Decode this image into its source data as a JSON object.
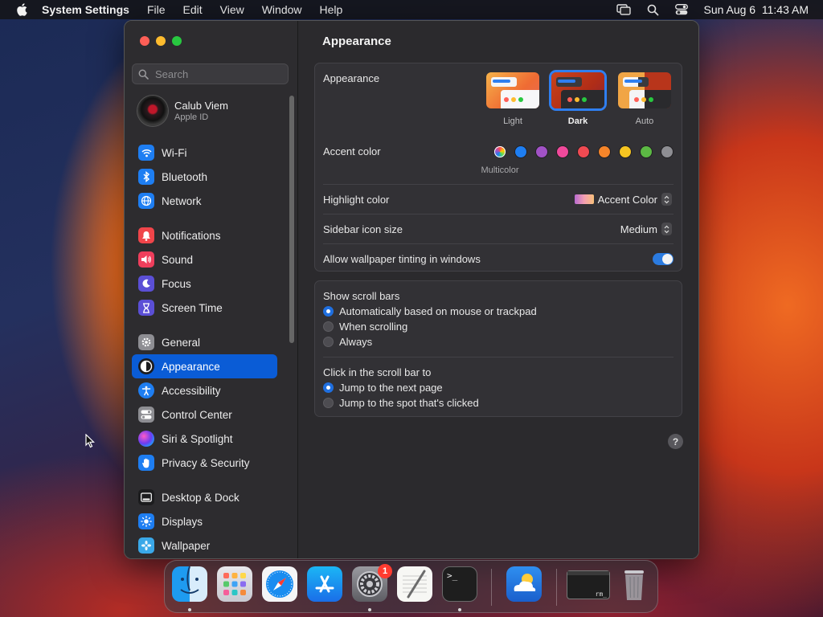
{
  "menubar": {
    "app_name": "System Settings",
    "menus": [
      "File",
      "Edit",
      "View",
      "Window",
      "Help"
    ],
    "clock": "Sun Aug 6  11:43 AM"
  },
  "sidebar": {
    "search_placeholder": "Search",
    "account": {
      "name": "Calub Viem",
      "subtitle": "Apple ID"
    },
    "sections": [
      [
        {
          "label": "Wi-Fi",
          "icon": "wifi-icon",
          "color": "#1e7ef2"
        },
        {
          "label": "Bluetooth",
          "icon": "bluetooth-icon",
          "color": "#1e7ef2"
        },
        {
          "label": "Network",
          "icon": "globe-icon",
          "color": "#1e7ef2"
        }
      ],
      [
        {
          "label": "Notifications",
          "icon": "bell-icon",
          "color": "#f0454a"
        },
        {
          "label": "Sound",
          "icon": "speaker-icon",
          "color": "#ef3e5c"
        },
        {
          "label": "Focus",
          "icon": "moon-icon",
          "color": "#5b4fd6"
        },
        {
          "label": "Screen Time",
          "icon": "hourglass-icon",
          "color": "#5b4fd6"
        }
      ],
      [
        {
          "label": "General",
          "icon": "gear-icon",
          "color": "#8e8e93"
        },
        {
          "label": "Appearance",
          "icon": "appearance-icon",
          "color": "#1c1c1e",
          "active": true
        },
        {
          "label": "Accessibility",
          "icon": "accessibility-icon",
          "color": "#1e7ef2"
        },
        {
          "label": "Control Center",
          "icon": "toggles-icon",
          "color": "#8e8e93"
        },
        {
          "label": "Siri & Spotlight",
          "icon": "siri-icon",
          "color": "#2b2b40"
        },
        {
          "label": "Privacy & Security",
          "icon": "hand-icon",
          "color": "#1e7ef2"
        }
      ],
      [
        {
          "label": "Desktop & Dock",
          "icon": "dock-icon",
          "color": "#1c1c1e"
        },
        {
          "label": "Displays",
          "icon": "sun-icon",
          "color": "#1e7ef2"
        },
        {
          "label": "Wallpaper",
          "icon": "flower-icon",
          "color": "#3aa8e8"
        }
      ]
    ]
  },
  "content": {
    "title": "Appearance",
    "appearance": {
      "label": "Appearance",
      "options": [
        {
          "label": "Light",
          "selected": false
        },
        {
          "label": "Dark",
          "selected": true
        },
        {
          "label": "Auto",
          "selected": false
        }
      ]
    },
    "accent": {
      "label": "Accent color",
      "caption": "Multicolor",
      "swatches": [
        "multicolor",
        "#1e7ef2",
        "#a152c6",
        "#f0499b",
        "#ef4a52",
        "#f5852a",
        "#f7c521",
        "#5cb944",
        "#8e8e93"
      ]
    },
    "highlight": {
      "label": "Highlight color",
      "value": "Accent Color"
    },
    "sidebar_icon_size": {
      "label": "Sidebar icon size",
      "value": "Medium"
    },
    "wallpaper_tinting": {
      "label": "Allow wallpaper tinting in windows",
      "on": true
    },
    "scroll_bars": {
      "label": "Show scroll bars",
      "options": [
        {
          "label": "Automatically based on mouse or trackpad",
          "selected": true
        },
        {
          "label": "When scrolling",
          "selected": false
        },
        {
          "label": "Always",
          "selected": false
        }
      ]
    },
    "click_scroll": {
      "label": "Click in the scroll bar to",
      "options": [
        {
          "label": "Jump to the next page",
          "selected": true
        },
        {
          "label": "Jump to the spot that's clicked",
          "selected": false
        }
      ]
    },
    "help_label": "?"
  },
  "dock": {
    "apps": [
      "Finder",
      "Launchpad",
      "Safari",
      "App Store",
      "System Settings",
      "TextEdit",
      "Terminal",
      "Weather",
      "rm window",
      "Trash"
    ],
    "settings_badge": "1",
    "terminal_glyph": ">_",
    "minimized_label": "rm_"
  }
}
